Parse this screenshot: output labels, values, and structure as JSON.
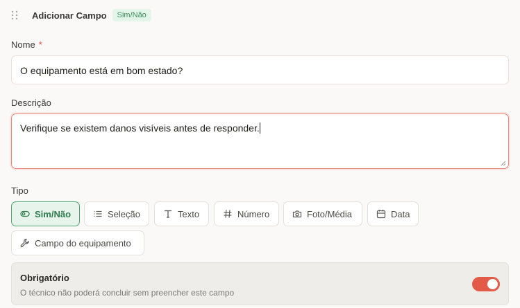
{
  "header": {
    "title": "Adicionar Campo",
    "badge": "Sim/Não"
  },
  "name_field": {
    "label": "Nome",
    "required_mark": "*",
    "value": "O equipamento está em bom estado?"
  },
  "description_field": {
    "label": "Descrição",
    "value": "Verifique se existem danos visíveis antes de responder."
  },
  "type_field": {
    "label": "Tipo",
    "options": [
      {
        "label": "Sim/Não",
        "icon": "toggle-icon",
        "selected": true
      },
      {
        "label": "Seleção",
        "icon": "list-icon",
        "selected": false
      },
      {
        "label": "Texto",
        "icon": "text-icon",
        "selected": false
      },
      {
        "label": "Número",
        "icon": "hash-icon",
        "selected": false
      },
      {
        "label": "Foto/Média",
        "icon": "camera-icon",
        "selected": false
      },
      {
        "label": "Data",
        "icon": "calendar-icon",
        "selected": false
      },
      {
        "label": "Campo do equipamento",
        "icon": "wrench-icon",
        "selected": false
      }
    ]
  },
  "required_section": {
    "title": "Obrigatório",
    "description": "O técnico não poderá concluir sem preencher este campo",
    "enabled": true
  },
  "colors": {
    "accent": "#e35a48",
    "selected_green": "#2f7d4f",
    "badge_bg": "#e3f4e9"
  }
}
